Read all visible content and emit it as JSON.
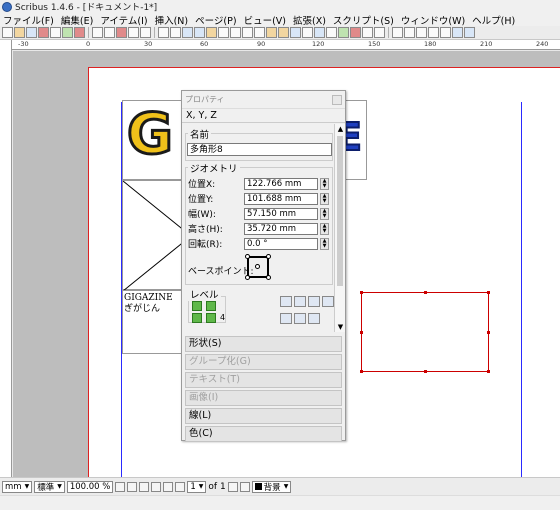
{
  "window": {
    "title": "Scribus 1.4.6 - [ドキュメント-1*]"
  },
  "menu": [
    "ファイル(F)",
    "編集(E)",
    "アイテム(I)",
    "挿入(N)",
    "ページ(P)",
    "ビュー(V)",
    "拡張(X)",
    "スクリプト(S)",
    "ウィンドウ(W)",
    "ヘルプ(H)"
  ],
  "ruler": {
    "labels": [
      "-30",
      "0",
      "30",
      "60",
      "90",
      "120",
      "150",
      "180",
      "210",
      "240"
    ]
  },
  "canvas": {
    "logo": {
      "left_text": "G",
      "right_text": "E"
    },
    "text_frame": {
      "line1": "GIGAZINE",
      "line2": "ぎがじん"
    }
  },
  "properties": {
    "title": "プロパティ",
    "xyz_label": "X, Y, Z",
    "name_label": "名前",
    "name_value": "多角形8",
    "geometry_label": "ジオメトリ",
    "geometry": [
      {
        "label": "位置X:",
        "value": "122.766 mm"
      },
      {
        "label": "位置Y:",
        "value": "101.688 mm"
      },
      {
        "label": "幅(W):",
        "value": "57.150 mm"
      },
      {
        "label": "高さ(H):",
        "value": "35.720 mm"
      },
      {
        "label": "回転(R):",
        "value": "0.0 °"
      }
    ],
    "basepoint_label": "ベースポイント:",
    "level_label": "レベル",
    "level_value": "4",
    "sections": [
      {
        "label": "形状(S)",
        "disabled": false
      },
      {
        "label": "グループ化(G)",
        "disabled": true
      },
      {
        "label": "テキスト(T)",
        "disabled": true
      },
      {
        "label": "画像(I)",
        "disabled": true
      },
      {
        "label": "線(L)",
        "disabled": false
      },
      {
        "label": "色(C)",
        "disabled": false
      }
    ]
  },
  "statusbar": {
    "unit": "mm",
    "mode": "標準",
    "zoom": "100.00 %",
    "page": "1",
    "of_pages": "of 1",
    "layer": "背景"
  }
}
